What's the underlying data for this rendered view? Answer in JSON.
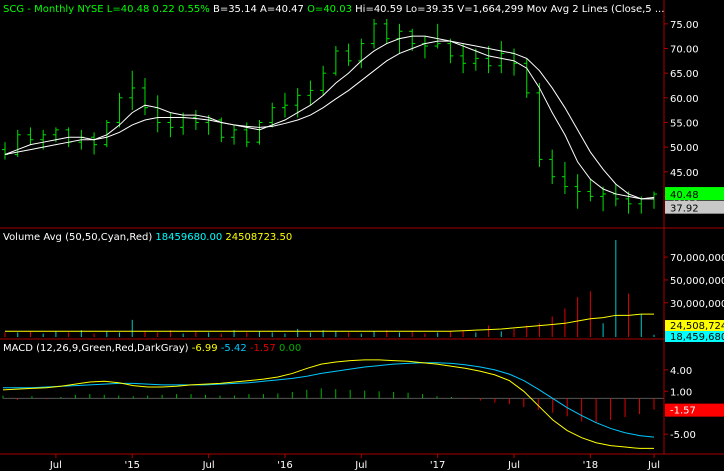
{
  "header": {
    "symbol": "SCG",
    "period": "Monthly",
    "exchange": "NYSE",
    "last": "L=40.48",
    "change": "0.22",
    "change_pct": "0.55%",
    "bid": "B=35.14",
    "ask": "A=40.47",
    "open": "O=40.03",
    "high": "Hi=40.59",
    "low": "Lo=39.35",
    "volume": "V=1,664,299",
    "study": "Mov Avg 2 Lines (Close,5 ..."
  },
  "colors": {
    "background": "#000000",
    "up_bar": "#00e000",
    "down_bar": "#00e000",
    "ma1": "#ffffff",
    "ma2": "#ffffff",
    "vol_up": "#00c8c8",
    "vol_down": "#e00000",
    "vol_avg": "#ffff00",
    "macd_line": "#ffff00",
    "signal_line": "#00c8ff",
    "hist_pos": "#00b000",
    "hist_neg": "#e00000",
    "price_badge": "#00ff00",
    "grey_badge": "#c8c8c8",
    "vol_badge1": "#ffff00",
    "vol_badge2": "#00ffff",
    "macd_badge": "#ff0000"
  },
  "chart_data": [
    {
      "type": "ohlc",
      "name": "price",
      "ylim": [
        34,
        77
      ],
      "yticks": [
        40,
        45,
        50,
        55,
        60,
        65,
        70,
        75
      ],
      "xticks": [
        "Jul",
        "'15",
        "Jul",
        "'16",
        "Jul",
        "'17",
        "Jul",
        "'18",
        "Jul"
      ],
      "bars": [
        [
          49.5,
          51.0,
          47.5,
          48.5
        ],
        [
          48.5,
          53.5,
          48.0,
          52.5
        ],
        [
          52.5,
          54.0,
          50.5,
          51.5
        ],
        [
          51.5,
          53.5,
          49.5,
          52.5
        ],
        [
          52.5,
          54.0,
          51.0,
          53.5
        ],
        [
          53.5,
          54.0,
          50.0,
          51.0
        ],
        [
          51.0,
          53.5,
          49.5,
          52.0
        ],
        [
          52.0,
          53.0,
          48.5,
          50.5
        ],
        [
          50.5,
          55.5,
          50.0,
          55.0
        ],
        [
          55.0,
          61.0,
          54.0,
          60.0
        ],
        [
          60.0,
          65.5,
          57.5,
          62.0
        ],
        [
          62.0,
          64.0,
          56.5,
          58.0
        ],
        [
          58.0,
          60.5,
          53.0,
          55.0
        ],
        [
          55.0,
          57.0,
          52.0,
          54.0
        ],
        [
          54.0,
          57.0,
          52.5,
          56.0
        ],
        [
          56.0,
          57.5,
          53.5,
          55.0
        ],
        [
          55.0,
          56.5,
          52.5,
          55.5
        ],
        [
          55.5,
          56.0,
          51.0,
          52.0
        ],
        [
          52.0,
          54.5,
          50.5,
          53.5
        ],
        [
          53.5,
          55.0,
          50.0,
          51.0
        ],
        [
          51.0,
          55.5,
          50.5,
          55.0
        ],
        [
          55.0,
          59.0,
          54.0,
          58.0
        ],
        [
          58.0,
          61.0,
          56.0,
          58.5
        ],
        [
          58.5,
          62.0,
          56.0,
          60.5
        ],
        [
          60.5,
          63.5,
          58.5,
          61.5
        ],
        [
          61.5,
          66.5,
          60.5,
          65.0
        ],
        [
          65.0,
          70.5,
          64.5,
          69.5
        ],
        [
          69.5,
          71.0,
          66.5,
          67.5
        ],
        [
          67.5,
          72.0,
          66.0,
          71.0
        ],
        [
          71.0,
          76.0,
          70.0,
          75.0
        ],
        [
          75.0,
          76.0,
          71.0,
          72.0
        ],
        [
          72.0,
          75.0,
          69.0,
          73.5
        ],
        [
          73.5,
          74.0,
          69.5,
          71.0
        ],
        [
          71.0,
          72.5,
          68.0,
          70.5
        ],
        [
          70.5,
          75.0,
          70.0,
          71.0
        ],
        [
          71.0,
          72.0,
          67.0,
          68.5
        ],
        [
          68.5,
          71.0,
          65.0,
          67.0
        ],
        [
          67.0,
          70.0,
          65.5,
          68.0
        ],
        [
          68.0,
          70.5,
          65.0,
          66.5
        ],
        [
          66.5,
          71.5,
          65.0,
          69.0
        ],
        [
          69.0,
          70.0,
          64.5,
          67.0
        ],
        [
          67.0,
          68.0,
          60.0,
          61.0
        ],
        [
          61.0,
          63.0,
          46.0,
          47.5
        ],
        [
          47.5,
          49.5,
          42.5,
          44.0
        ],
        [
          44.0,
          47.0,
          40.5,
          42.0
        ],
        [
          42.0,
          44.5,
          37.5,
          41.0
        ],
        [
          41.0,
          43.5,
          39.0,
          40.0
        ],
        [
          40.0,
          42.0,
          37.0,
          40.5
        ],
        [
          40.5,
          42.5,
          38.0,
          39.5
        ],
        [
          39.5,
          41.0,
          36.5,
          38.5
        ],
        [
          38.5,
          40.0,
          36.5,
          39.5
        ],
        [
          39.5,
          41.0,
          37.5,
          40.48
        ]
      ],
      "ma_fast": [
        48.5,
        49.5,
        50.5,
        51.0,
        51.5,
        52.0,
        52.0,
        51.5,
        52.5,
        54.5,
        57.0,
        58.5,
        58.0,
        57.0,
        56.5,
        56.5,
        56.0,
        55.0,
        54.5,
        54.0,
        53.5,
        54.5,
        55.5,
        57.0,
        58.5,
        60.5,
        63.0,
        65.0,
        67.5,
        69.5,
        71.0,
        72.0,
        72.5,
        72.5,
        72.0,
        71.5,
        70.5,
        69.5,
        68.5,
        68.0,
        67.5,
        66.0,
        62.0,
        57.0,
        52.5,
        47.0,
        43.5,
        41.5,
        40.5,
        40.0,
        39.5,
        39.8
      ],
      "ma_slow": [
        48.5,
        49.0,
        49.5,
        50.0,
        50.5,
        51.0,
        51.5,
        51.5,
        52.0,
        53.0,
        54.5,
        55.5,
        56.0,
        56.0,
        56.0,
        55.8,
        55.5,
        55.0,
        54.5,
        54.2,
        54.0,
        54.2,
        54.8,
        55.5,
        56.5,
        58.0,
        59.8,
        61.5,
        63.5,
        65.5,
        67.5,
        69.0,
        70.0,
        71.0,
        71.5,
        71.5,
        71.0,
        70.5,
        70.0,
        69.5,
        69.0,
        68.0,
        65.5,
        62.0,
        58.0,
        53.5,
        49.0,
        45.5,
        42.5,
        40.5,
        39.5,
        39.5
      ],
      "last_labels": [
        "40.48",
        "37.92"
      ]
    },
    {
      "type": "bar",
      "name": "volume",
      "title": "Volume Avg (50,50,Cyan,Red)",
      "avg_value": "18459680.00",
      "avg2_value": "24508723.50",
      "ylim": [
        0,
        85000000
      ],
      "yticks": [
        "70,000,000",
        "50,000,000",
        "30,000,000"
      ],
      "values": [
        4,
        4,
        5,
        3,
        5,
        4,
        6,
        3,
        5,
        4,
        15,
        5,
        4,
        6,
        3,
        5,
        4,
        3,
        6,
        4,
        5,
        4,
        3,
        7,
        4,
        6,
        5,
        4,
        3,
        5,
        6,
        4,
        5,
        3,
        4,
        5,
        6,
        4,
        10,
        5,
        7,
        10,
        12,
        18,
        25,
        35,
        40,
        12,
        85,
        38,
        20,
        2
      ],
      "up": [
        0,
        1,
        0,
        1,
        1,
        0,
        1,
        0,
        1,
        1,
        1,
        0,
        0,
        0,
        1,
        0,
        1,
        0,
        1,
        0,
        1,
        1,
        1,
        1,
        1,
        1,
        1,
        0,
        1,
        1,
        0,
        1,
        0,
        0,
        1,
        0,
        0,
        1,
        0,
        1,
        0,
        0,
        0,
        0,
        0,
        0,
        0,
        1,
        1,
        0,
        1,
        1
      ],
      "avg_line": [
        5,
        5,
        5,
        5,
        5,
        5,
        5,
        5,
        5,
        5,
        5,
        5,
        5,
        5,
        5,
        5,
        5,
        5,
        5,
        5,
        5,
        5,
        5,
        5,
        5,
        5,
        5,
        5,
        5,
        5,
        5,
        5,
        5,
        5,
        5,
        5,
        5.5,
        6,
        6.5,
        7,
        8,
        9,
        10,
        11,
        12,
        14,
        16,
        17,
        19,
        19,
        20,
        20
      ],
      "last_labels": [
        "24,508,724",
        "18,459,680"
      ]
    },
    {
      "type": "line",
      "name": "macd",
      "title": "MACD (12,26,9,Green,Red,DarkGray)",
      "values_text": [
        "-6.99",
        "-5.42",
        "-1.57",
        "0.00"
      ],
      "ylim": [
        -7.5,
        6.5
      ],
      "yticks": [
        "4.00",
        "1.00",
        "-5.00"
      ],
      "macd": [
        1.2,
        1.3,
        1.4,
        1.5,
        1.7,
        2.0,
        2.3,
        2.4,
        2.2,
        1.8,
        1.6,
        1.6,
        1.7,
        1.9,
        2.0,
        2.1,
        2.3,
        2.5,
        2.7,
        3.0,
        3.5,
        4.2,
        4.8,
        5.1,
        5.3,
        5.4,
        5.4,
        5.3,
        5.2,
        5.0,
        4.8,
        4.5,
        4.2,
        3.8,
        3.3,
        2.5,
        1.0,
        -1.0,
        -3.0,
        -4.5,
        -5.5,
        -6.2,
        -6.6,
        -6.8,
        -7.0,
        -6.99
      ],
      "signal": [
        1.5,
        1.5,
        1.5,
        1.6,
        1.7,
        1.8,
        1.9,
        2.0,
        2.1,
        2.1,
        2.0,
        1.9,
        1.9,
        1.9,
        1.9,
        2.0,
        2.1,
        2.2,
        2.4,
        2.6,
        2.8,
        3.1,
        3.5,
        3.8,
        4.1,
        4.4,
        4.6,
        4.8,
        4.9,
        5.0,
        5.0,
        4.9,
        4.7,
        4.4,
        4.0,
        3.4,
        2.5,
        1.3,
        0.0,
        -1.3,
        -2.4,
        -3.4,
        -4.2,
        -4.8,
        -5.2,
        -5.42
      ],
      "hist": [
        0.4,
        -0.2,
        0.3,
        -0.1,
        0.2,
        0.5,
        0.6,
        0.5,
        0.4,
        0.3,
        0.4,
        0.5,
        0.6,
        0.6,
        0.5,
        0.4,
        0.4,
        0.6,
        0.6,
        0.7,
        0.9,
        1.2,
        1.4,
        1.3,
        1.2,
        1.1,
        1.0,
        0.9,
        0.8,
        0.6,
        0.3,
        0.2,
        -0.1,
        -0.3,
        -0.6,
        -0.8,
        -1.2,
        -1.6,
        -2.0,
        -2.5,
        -3.2,
        -3.4,
        -3.0,
        -2.6,
        -2.2,
        -1.57
      ],
      "last_labels": [
        "-1.57"
      ]
    }
  ]
}
